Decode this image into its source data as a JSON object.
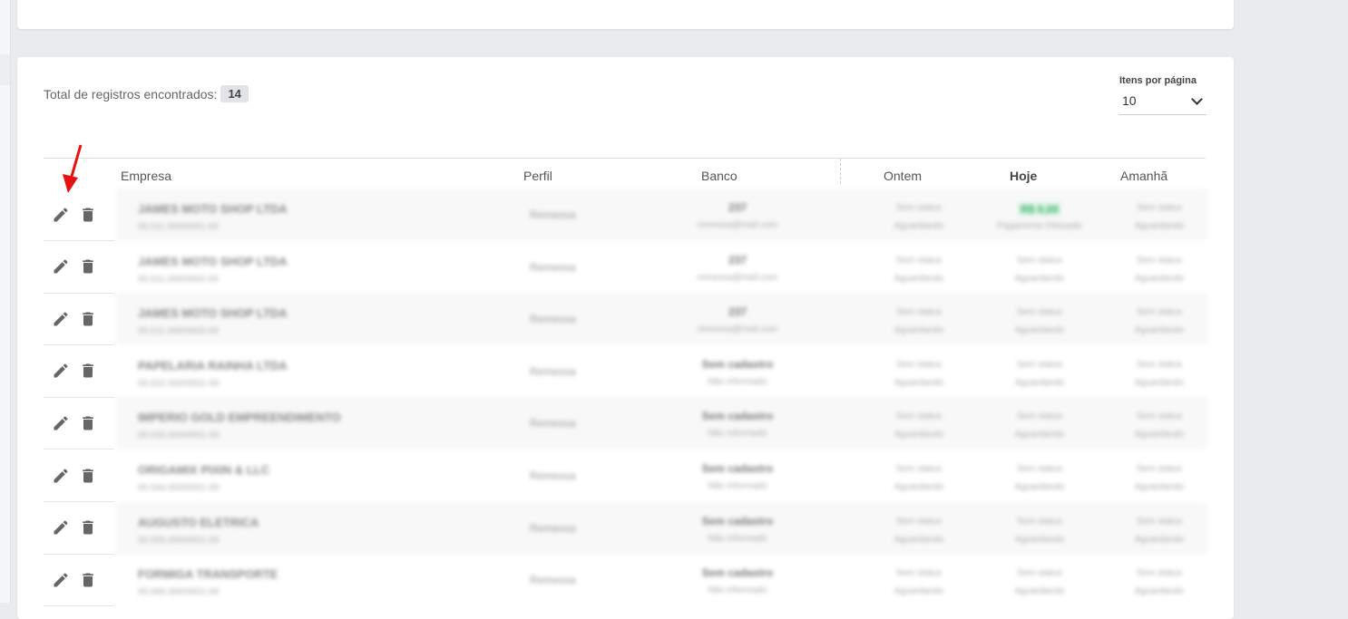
{
  "summary": {
    "total_label": "Total de registros encontrados:",
    "total_count": "14"
  },
  "pagination": {
    "per_page_label": "Itens por página",
    "per_page_value": "10"
  },
  "table": {
    "headers": {
      "empresa": "Empresa",
      "perfil": "Perfil",
      "banco": "Banco",
      "ontem": "Ontem",
      "hoje": "Hoje",
      "amanha": "Amanhã"
    },
    "rows": [
      {
        "empresa": "JAMES MOTO SHOP LTDA",
        "doc": "00.011.000/0001-00",
        "perfil": "Remessa",
        "banco": "237",
        "banco_sub": "remessa@mail.com",
        "ontem": "Sem status",
        "ontem_sub": "Aguardando",
        "hoje": "R$ 0,00",
        "hoje_sub": "Pagamento Efetuado",
        "amanha": "Sem status",
        "amanha_sub": "Aguardando"
      },
      {
        "empresa": "JAMES MOTO SHOP LTDA",
        "doc": "00.011.000/0002-00",
        "perfil": "Remessa",
        "banco": "237",
        "banco_sub": "remessa@mail.com",
        "ontem": "Sem status",
        "ontem_sub": "Aguardando",
        "hoje": "Sem status",
        "hoje_sub": "Aguardando",
        "amanha": "Sem status",
        "amanha_sub": "Aguardando"
      },
      {
        "empresa": "JAMES MOTO SHOP LTDA",
        "doc": "00.011.000/0003-00",
        "perfil": "Remessa",
        "banco": "237",
        "banco_sub": "remessa@mail.com",
        "ontem": "Sem status",
        "ontem_sub": "Aguardando",
        "hoje": "Sem status",
        "hoje_sub": "Aguardando",
        "amanha": "Sem status",
        "amanha_sub": "Aguardando"
      },
      {
        "empresa": "PAPELARIA RAINHA LTDA",
        "doc": "00.022.000/0001-00",
        "perfil": "Remessa",
        "banco": "Sem cadastro",
        "banco_sub": "Não informado",
        "ontem": "Sem status",
        "ontem_sub": "Aguardando",
        "hoje": "Sem status",
        "hoje_sub": "Aguardando",
        "amanha": "Sem status",
        "amanha_sub": "Aguardando"
      },
      {
        "empresa": "IMPERIO GOLD EMPREENDIMENTO",
        "doc": "00.033.000/0001-00",
        "perfil": "Remessa",
        "banco": "Sem cadastro",
        "banco_sub": "Não informado",
        "ontem": "Sem status",
        "ontem_sub": "Aguardando",
        "hoje": "Sem status",
        "hoje_sub": "Aguardando",
        "amanha": "Sem status",
        "amanha_sub": "Aguardando"
      },
      {
        "empresa": "ORIGAMIX PIXIN & LLC",
        "doc": "00.044.000/0001-00",
        "perfil": "Remessa",
        "banco": "Sem cadastro",
        "banco_sub": "Não informado",
        "ontem": "Sem status",
        "ontem_sub": "Aguardando",
        "hoje": "Sem status",
        "hoje_sub": "Aguardando",
        "amanha": "Sem status",
        "amanha_sub": "Aguardando"
      },
      {
        "empresa": "AUGUSTO ELETRICA",
        "doc": "00.055.000/0001-00",
        "perfil": "Remessa",
        "banco": "Sem cadastro",
        "banco_sub": "Não informado",
        "ontem": "Sem status",
        "ontem_sub": "Aguardando",
        "hoje": "Sem status",
        "hoje_sub": "Aguardando",
        "amanha": "Sem status",
        "amanha_sub": "Aguardando"
      },
      {
        "empresa": "FORMIGA TRANSPORTE",
        "doc": "00.066.000/0001-00",
        "perfil": "Remessa",
        "banco": "Sem cadastro",
        "banco_sub": "Não informado",
        "ontem": "Sem status",
        "ontem_sub": "Aguardando",
        "hoje": "Sem status",
        "hoje_sub": "Aguardando",
        "amanha": "Sem status",
        "amanha_sub": "Aguardando"
      }
    ]
  },
  "colors": {
    "accent_arrow": "#e81010",
    "icon": "#666666",
    "hoje_green": "#27ae60"
  }
}
